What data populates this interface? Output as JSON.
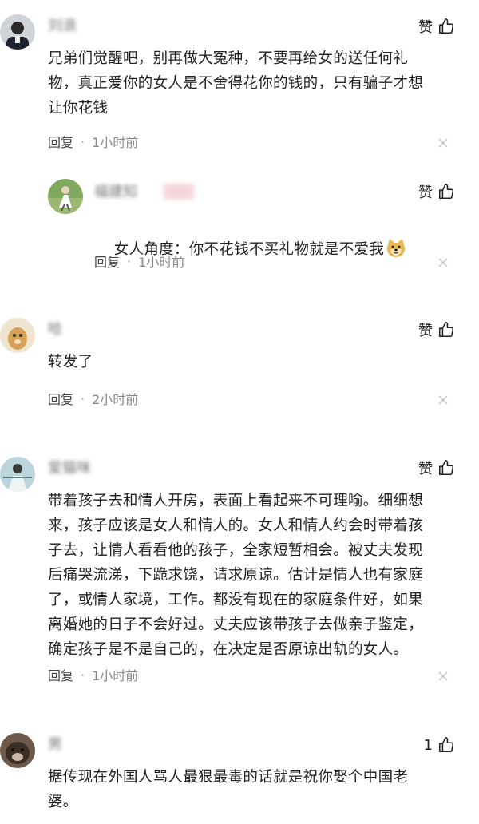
{
  "comments": [
    {
      "user": "刘浪",
      "like_label": "赞",
      "text": "兄弟们觉醒吧，别再做大冤种，不要再给女的送任何礼\n物，真正爱你的女人是不舍得花你的钱的，只有骗子才想\n让你花钱",
      "reply_label": "回复",
      "separator": "·",
      "time": "1小时前"
    },
    {
      "user": "福建知",
      "like_label": "赞",
      "text": "女人角度：你不花钱不买礼物就是不爱我",
      "reply_label": "回复",
      "separator": "·",
      "time": "1小时前"
    },
    {
      "user": "哈",
      "like_label": "赞",
      "text": "转发了",
      "reply_label": "回复",
      "separator": "·",
      "time": "2小时前"
    },
    {
      "user": "爱猫咪",
      "like_label": "赞",
      "text": "带着孩子去和情人开房，表面上看起来不可理喻。细细想\n来，孩子应该是女人和情人的。女人和情人约会时带着孩\n子去，让情人看看他的孩子，全家短暂相会。被丈夫发现\n后痛哭流涕，下跪求饶，请求原谅。估计是情人也有家庭\n了，或情人家境，工作。都没有现在的家庭条件好，如果\n离婚她的日子不会好过。丈夫应该带孩子去做亲子鉴定，\n确定孩子是不是自己的，在决定是否原谅出轨的女人。",
      "reply_label": "回复",
      "separator": "·",
      "time": "1小时前"
    },
    {
      "user": "男",
      "like_label": "1",
      "text": "据传现在外国人骂人最狠最毒的话就是祝你娶个中国老\n婆。"
    }
  ],
  "icons": {
    "like": "thumbs-up-icon",
    "close": "close-icon",
    "emoji": "doge-emoji-icon"
  },
  "colors": {
    "text": "#222222",
    "meta": "#888888",
    "close": "#c4c4c4"
  }
}
